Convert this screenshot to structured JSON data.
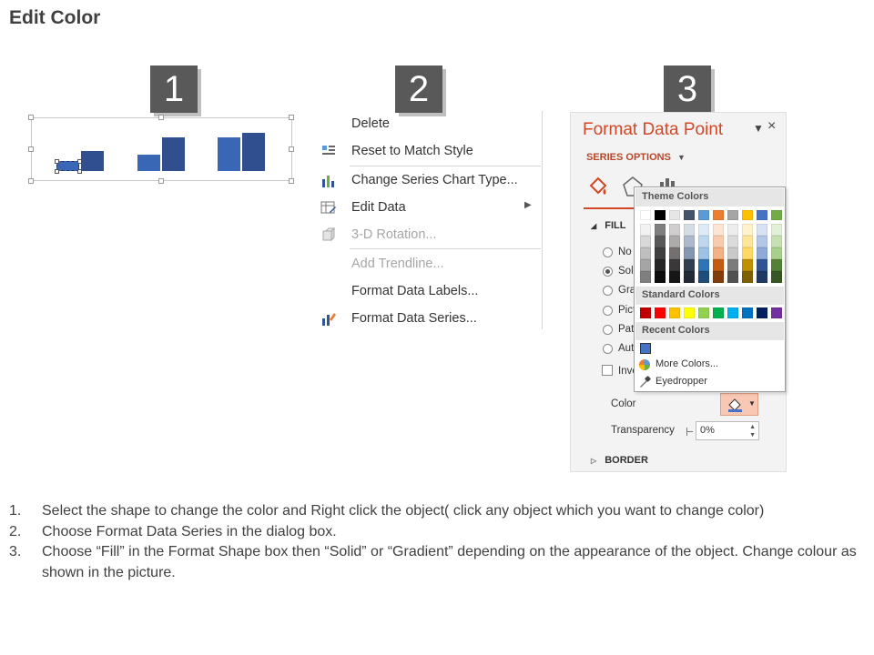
{
  "title": "Edit Color",
  "steps": [
    "1",
    "2",
    "3"
  ],
  "chart": {
    "type": "bar",
    "groups": [
      {
        "values": [
          1,
          2
        ]
      },
      {
        "values": [
          1.6,
          3.4
        ]
      },
      {
        "values": [
          3.4,
          3.8
        ]
      }
    ],
    "colors": [
      "#3a66b6",
      "#2f4f8f"
    ]
  },
  "context_menu": {
    "items": [
      {
        "label": "Delete",
        "icon": "delete",
        "enabled": true
      },
      {
        "label": "Reset to Match Style",
        "icon": "reset-style-icon",
        "enabled": true
      },
      {
        "label": "Change Series Chart Type...",
        "icon": "chart-type-icon",
        "enabled": true
      },
      {
        "label": "Edit Data",
        "icon": "edit-data-icon",
        "enabled": true,
        "submenu": true
      },
      {
        "label": "3-D Rotation...",
        "icon": "rotation-icon",
        "enabled": false
      },
      {
        "label": "Add Trendline...",
        "icon": "",
        "enabled": false
      },
      {
        "label": "Format Data Labels...",
        "icon": "",
        "enabled": true
      },
      {
        "label": "Format Data Series...",
        "icon": "format-series-icon",
        "enabled": true
      }
    ]
  },
  "format_pane": {
    "title": "Format Data Point",
    "series_options": "SERIES OPTIONS",
    "fill_section": "FILL",
    "fill_options": [
      {
        "label": "No",
        "checked": false
      },
      {
        "label": "Soli",
        "checked": true
      },
      {
        "label": "Gra",
        "checked": false
      },
      {
        "label": "Pict",
        "checked": false
      },
      {
        "label": "Patt",
        "checked": false
      },
      {
        "label": "Aut",
        "checked": false
      }
    ],
    "invert_label": "Inve",
    "color_label": "Color",
    "transparency_label": "Transparency",
    "transparency_value": "0%",
    "border_section": "BORDER",
    "accent": "#d24726"
  },
  "color_dropdown": {
    "theme_colors_label": "Theme Colors",
    "standard_colors_label": "Standard Colors",
    "recent_colors_label": "Recent Colors",
    "more_colors_label": "More Colors...",
    "eyedropper_label": "Eyedropper",
    "theme_base": [
      "#ffffff",
      "#000000",
      "#e7e6e6",
      "#44546a",
      "#5b9bd5",
      "#ed7d31",
      "#a5a5a5",
      "#ffc000",
      "#4472c4",
      "#70ad47"
    ],
    "theme_shades": [
      [
        "#f2f2f2",
        "#7f7f7f",
        "#d0cece",
        "#d6dce4",
        "#deebf6",
        "#fbe5d5",
        "#ededed",
        "#fff2cc",
        "#d9e2f3",
        "#e2efd9"
      ],
      [
        "#d8d8d8",
        "#595959",
        "#aeabab",
        "#adb9ca",
        "#bdd7ee",
        "#f7cbac",
        "#dbdbdb",
        "#fee599",
        "#b4c6e7",
        "#c5e0b3"
      ],
      [
        "#bfbfbf",
        "#3f3f3f",
        "#757070",
        "#8496b0",
        "#9cc3e5",
        "#f4b183",
        "#c9c9c9",
        "#ffd965",
        "#8eaadb",
        "#a8d08d"
      ],
      [
        "#a5a5a5",
        "#262626",
        "#3a3838",
        "#323f4f",
        "#2e75b5",
        "#c55a11",
        "#7b7b7b",
        "#bf9000",
        "#2f5496",
        "#538135"
      ],
      [
        "#7f7f7f",
        "#0c0c0c",
        "#171616",
        "#222a35",
        "#1e4e79",
        "#833c0b",
        "#525252",
        "#7f6000",
        "#1f3864",
        "#375623"
      ]
    ],
    "standard": [
      "#c00000",
      "#ff0000",
      "#ffc000",
      "#ffff00",
      "#92d050",
      "#00b050",
      "#00b0f0",
      "#0070c0",
      "#002060",
      "#7030a0"
    ],
    "recent": [
      "#4472c4"
    ]
  },
  "instructions": [
    {
      "num": "1.",
      "text": "Select the shape to change the color and Right click the object( click any object which you want to change color)"
    },
    {
      "num": "2.",
      "text": "Choose Format Data Series in the dialog box."
    },
    {
      "num": "3.",
      "text": "Choose “Fill” in the Format Shape box then “Solid” or “Gradient” depending on the appearance of the object. Change colour as shown in the picture."
    }
  ]
}
